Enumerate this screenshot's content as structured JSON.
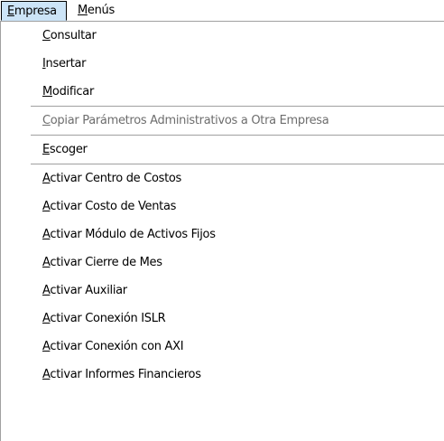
{
  "menubar": {
    "items": [
      {
        "access_key": "E",
        "rest": "mpresa",
        "state": "open"
      },
      {
        "access_key": "M",
        "rest": "enús",
        "state": "normal"
      }
    ]
  },
  "dropdown": {
    "groups": [
      [
        {
          "access_key": "C",
          "rest": "onsultar",
          "enabled": true
        },
        {
          "access_key": "I",
          "rest": "nsertar",
          "enabled": true
        },
        {
          "access_key": "M",
          "rest": "odificar",
          "enabled": true
        }
      ],
      [
        {
          "access_key": "C",
          "rest": "opiar Parámetros Administrativos a Otra Empresa",
          "enabled": false
        }
      ],
      [
        {
          "access_key": "E",
          "rest": "scoger",
          "enabled": true
        }
      ],
      [
        {
          "access_key": "A",
          "rest": "ctivar Centro de Costos",
          "enabled": true
        },
        {
          "access_key": "A",
          "rest": "ctivar Costo de Ventas",
          "enabled": true
        },
        {
          "access_key": "A",
          "rest": "ctivar Módulo de Activos Fijos",
          "enabled": true
        },
        {
          "access_key": "A",
          "rest": "ctivar Cierre de Mes",
          "enabled": true
        },
        {
          "access_key": "A",
          "rest": "ctivar Auxiliar",
          "enabled": true
        },
        {
          "access_key": "A",
          "rest": "ctivar Conexión ISLR",
          "enabled": true
        },
        {
          "access_key": "A",
          "rest": "ctivar Conexión con AXI",
          "enabled": true
        },
        {
          "access_key": "A",
          "rest": "ctivar Informes Financieros",
          "enabled": true
        }
      ]
    ]
  },
  "colors": {
    "open_menu_highlight": "#cce4f7",
    "disabled_text": "#6d6d6d",
    "separator": "#a0a0a0"
  }
}
